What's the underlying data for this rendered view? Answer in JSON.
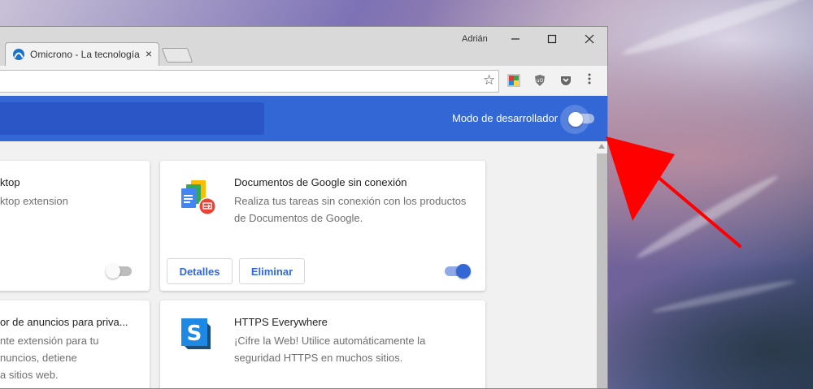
{
  "window": {
    "profile_name": "Adrián",
    "tab": {
      "title": "Omicrono - La tecnología",
      "close_glyph": "×"
    },
    "controls": {
      "minimize": "—",
      "maximize": "☐",
      "close": "✕"
    }
  },
  "toolbar": {
    "star_glyph": "☆",
    "menu_glyph": "⋮",
    "extension_icons": [
      "color-picker-icon",
      "ublock-icon",
      "pocket-icon"
    ]
  },
  "extensions_header": {
    "dev_mode_label": "Modo de desarrollador",
    "dev_mode_enabled": false
  },
  "extensions": [
    {
      "title": "ktop",
      "description": [
        "ktop extension"
      ],
      "enabled": false
    },
    {
      "title": "Documentos de Google sin conexión",
      "description": [
        "Realiza tus tareas sin conexión con los productos",
        "de Documentos de Google."
      ],
      "details_label": "Detalles",
      "remove_label": "Eliminar",
      "enabled": true,
      "icon": "google-docs-offline-icon"
    },
    {
      "title": "or de anuncios para priva...",
      "description": [
        "nte extensión para tu",
        "nuncios, detiene",
        "a sitios web."
      ]
    },
    {
      "title": "HTTPS Everywhere",
      "description": [
        "¡Cifre la Web! Utilice automáticamente la",
        "seguridad HTTPS en muchos sitios."
      ],
      "icon": "https-everywhere-icon",
      "icon_letter": "S"
    }
  ],
  "colors": {
    "accent": "#3367d6",
    "header": "#3367d6",
    "arrow": "#ff0000"
  }
}
